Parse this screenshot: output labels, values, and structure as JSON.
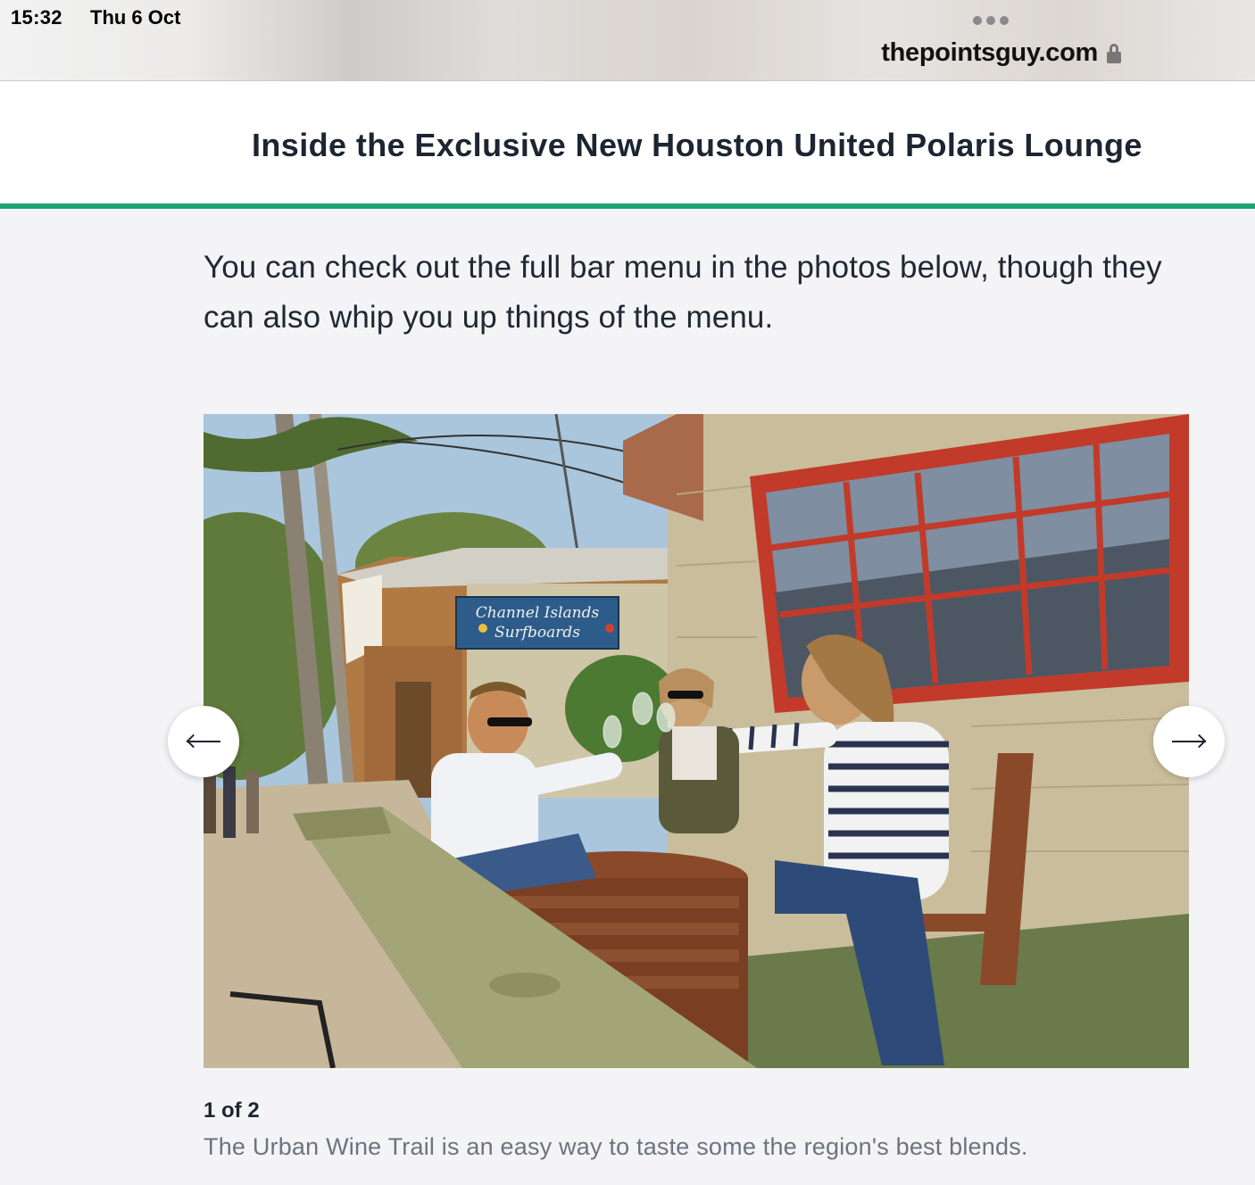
{
  "status_bar": {
    "time": "15:32",
    "date": "Thu 6 Oct"
  },
  "browser": {
    "url": "thepointsguy.com",
    "more_icon": "ellipsis-icon",
    "lock_icon": "lock-icon"
  },
  "article": {
    "title": "Inside the Exclusive New Houston United Polaris Lounge",
    "accent_color": "#1ea672",
    "paragraph": "You can check out the full bar menu in the photos below, though they can also whip you up things of the menu."
  },
  "gallery": {
    "counter": "1 of 2",
    "caption": "The Urban Wine Trail is an easy way to taste some the region's best blends.",
    "sign_line1": "Channel Islands",
    "sign_line2": "Surfboards",
    "prev_icon": "arrow-left-icon",
    "next_icon": "arrow-right-icon"
  }
}
